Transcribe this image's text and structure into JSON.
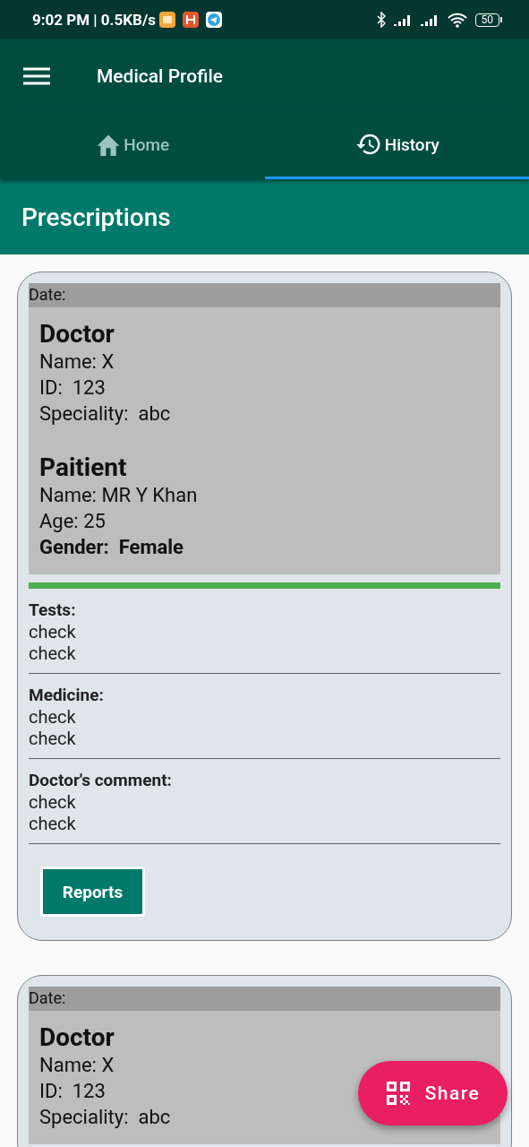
{
  "status_bar": {
    "time": "9:02 PM | 0.5KB/s",
    "battery": "50"
  },
  "app_bar": {
    "title": "Medical Profile"
  },
  "tabs": [
    {
      "label": "Home",
      "kind": "home",
      "selected": false
    },
    {
      "label": "History",
      "kind": "history",
      "selected": true
    }
  ],
  "section_title": "Prescriptions",
  "prescriptions": [
    {
      "date": "Date:",
      "doctor": {
        "heading": "Doctor",
        "lines": [
          {
            "text": "Name: X",
            "kind": "plain"
          },
          {
            "text": "ID:  123",
            "kind": "plain"
          },
          {
            "text": "Speciality:  abc",
            "kind": "plain"
          }
        ]
      },
      "patient": {
        "heading": "Paitient",
        "lines": [
          {
            "text": "Name: MR Y Khan",
            "kind": "plain"
          },
          {
            "text": "Age: 25",
            "kind": "plain"
          },
          {
            "text": "Gender:  Female",
            "kind": "bold"
          }
        ]
      },
      "sections": [
        {
          "label": "Tests:",
          "lines": [
            "check",
            "check"
          ]
        },
        {
          "label": "Medicine:",
          "lines": [
            "check",
            "check"
          ]
        },
        {
          "label": "Doctor's comment:",
          "lines": [
            "check",
            "check"
          ]
        }
      ],
      "button": "Reports"
    },
    {
      "date": "Date:",
      "doctor": {
        "heading": "Doctor",
        "lines": [
          {
            "text": "Name: X",
            "kind": "plain"
          },
          {
            "text": "ID:  123",
            "kind": "plain"
          },
          {
            "text": "Speciality:  abc",
            "kind": "plain"
          }
        ]
      }
    }
  ],
  "fab": {
    "label": "Share"
  }
}
